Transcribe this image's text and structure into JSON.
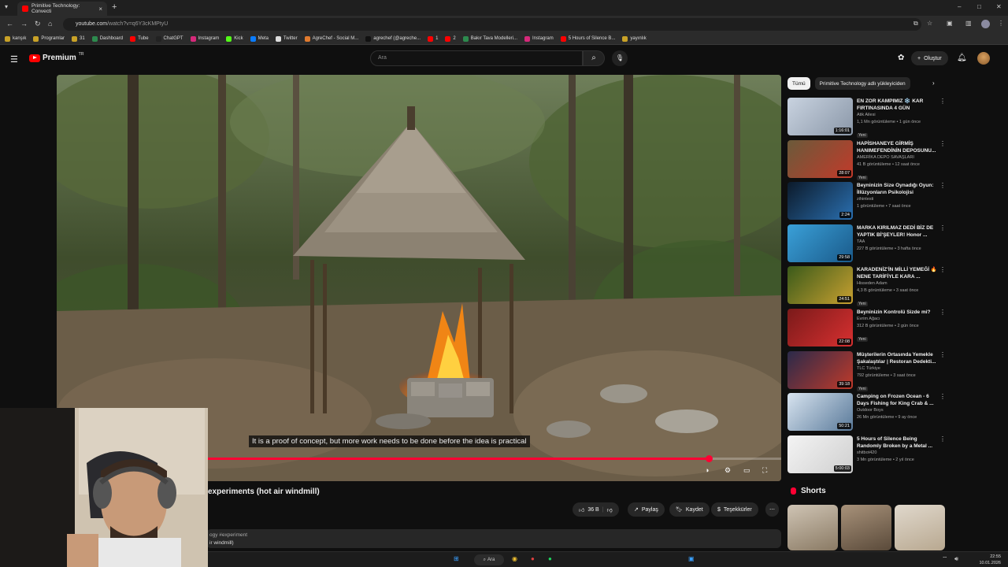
{
  "browser": {
    "tab_title": "Primitive Technology: Convecti",
    "url_host": "youtube.com",
    "url_path": "/watch?v=q6Y3cKMPtyU",
    "bookmarks": [
      {
        "label": "kanşık",
        "color": "#c9a227"
      },
      {
        "label": "Programlar",
        "color": "#c9a227"
      },
      {
        "label": "31",
        "color": "#c9a227"
      },
      {
        "label": "Dashboard",
        "color": "#2d8a4e"
      },
      {
        "label": "Tube",
        "color": "#ff0000"
      },
      {
        "label": "ChatGPT",
        "color": "#222222"
      },
      {
        "label": "Instagram",
        "color": "#d6297a"
      },
      {
        "label": "Kick",
        "color": "#53fc18"
      },
      {
        "label": "Meta",
        "color": "#0a7cff"
      },
      {
        "label": "Twitter",
        "color": "#dddddd"
      },
      {
        "label": "AgreChef - Social M...",
        "color": "#e07a2e"
      },
      {
        "label": "agrechef (@agreche...",
        "color": "#111111"
      },
      {
        "label": "1",
        "color": "#ff0000"
      },
      {
        "label": "2",
        "color": "#ff0000"
      },
      {
        "label": "Bakır Tava Modelleri...",
        "color": "#2d8a4e"
      },
      {
        "label": "Instagram",
        "color": "#d6297a"
      },
      {
        "label": "5 Hours of Silence B...",
        "color": "#ff0000"
      },
      {
        "label": "yayınlık",
        "color": "#c9a227"
      }
    ]
  },
  "header": {
    "brand": "Premium",
    "brand_suffix": "TR",
    "search_placeholder": "Ara",
    "create_label": "Oluştur"
  },
  "video": {
    "caption": "It is a proof of concept, but more work needs to be done before the idea is practical",
    "progress_fraction": 0.9,
    "title": "experiments (hot air windmill)",
    "like_count": "36 B",
    "share_label": "Paylaş",
    "save_label": "Kaydet",
    "thanks_label": "Teşekkürler",
    "desc_tags": "ogy #experiment",
    "desc_line2": "ir windmill)"
  },
  "chips": {
    "all": "Tümü",
    "channel": "Primitive Technology adlı yükleyiciden"
  },
  "recommendations": [
    {
      "title": "EN ZOR KAMPIMIZ ❄️ KAR FIRTINASINDA 4 GÜN",
      "channel": "Atik Ailesi",
      "stats": "1,1 Mn görüntüleme • 1 gün önce",
      "badge": "Yeni",
      "duration": "1:16:01",
      "thumb": [
        "#c9d3e0",
        "#8a97a8"
      ]
    },
    {
      "title": "HAPİSHANEYE GİRMİŞ HANIMEFENDİNİN DEPOSUNU...",
      "channel": "AMERİKA DEPO SAVAŞLARI",
      "stats": "41 B görüntüleme • 12 saat önce",
      "badge": "Yeni",
      "duration": "28:07",
      "thumb": [
        "#6a5a3a",
        "#c23a2a"
      ]
    },
    {
      "title": "Beyninizin Size Oynadığı Oyun: İllüzyonların Psikolojisi",
      "channel": "zihintesti",
      "stats": "1 görüntüleme • 7 saat önce",
      "badge": "",
      "duration": "2:24",
      "thumb": [
        "#0c1a2a",
        "#2a6fb0"
      ]
    },
    {
      "title": "MARKA KIRILMAZ DEDİ BİZ DE YAPTIK Bİ'ŞEYLER! Honor ...",
      "channel": "TAA",
      "stats": "227 B görüntüleme • 3 hafta önce",
      "badge": "",
      "duration": "29:58",
      "thumb": [
        "#3aa0d8",
        "#1a5a8a"
      ]
    },
    {
      "title": "KARADENİZ'İN MİLLİ YEMEĞİ 🔥 NENE TARİFİYLE KARA ...",
      "channel": "Hisseden Adam",
      "stats": "4,3 B görüntüleme • 3 saat önce",
      "badge": "Yeni",
      "duration": "24:51",
      "thumb": [
        "#3a5a1a",
        "#c8a030"
      ]
    },
    {
      "title": "Beyninizin Kontrolü Sizde mi?",
      "channel": "Evrim Ağacı",
      "stats": "312 B görüntüleme • 2 gün önce",
      "badge": "Yeni",
      "duration": "22:08",
      "thumb": [
        "#7a1a1a",
        "#d83030"
      ]
    },
    {
      "title": "Müşterilerin Ortasında Yemekle Şakalaştılar | Restoran Dedekti...",
      "channel": "TLC Türkiye",
      "stats": "792 görüntüleme • 3 saat önce",
      "badge": "Yeni",
      "duration": "39:18",
      "thumb": [
        "#2a2a4a",
        "#c03a2a"
      ]
    },
    {
      "title": "Camping on Frozen Ocean - 6 Days Fishing for King Crab & ...",
      "channel": "Outdoor Boys",
      "stats": "26 Mn görüntüleme • 9 ay önce",
      "badge": "",
      "duration": "50:21",
      "thumb": [
        "#d8e4f0",
        "#5a7a9a"
      ]
    },
    {
      "title": "5 Hours of Silence Being Randomly Broken by a Metal ...",
      "channel": "shitbot420",
      "stats": "3 Mn görüntüleme • 2 yıl önce",
      "badge": "",
      "duration": "5:00:03",
      "thumb": [
        "#f4f4f4",
        "#cfcfcf"
      ]
    }
  ],
  "shorts": {
    "heading": "Shorts"
  },
  "taskbar": {
    "search_label": "Ara",
    "time": "22:55",
    "date": "10.01.2026"
  }
}
